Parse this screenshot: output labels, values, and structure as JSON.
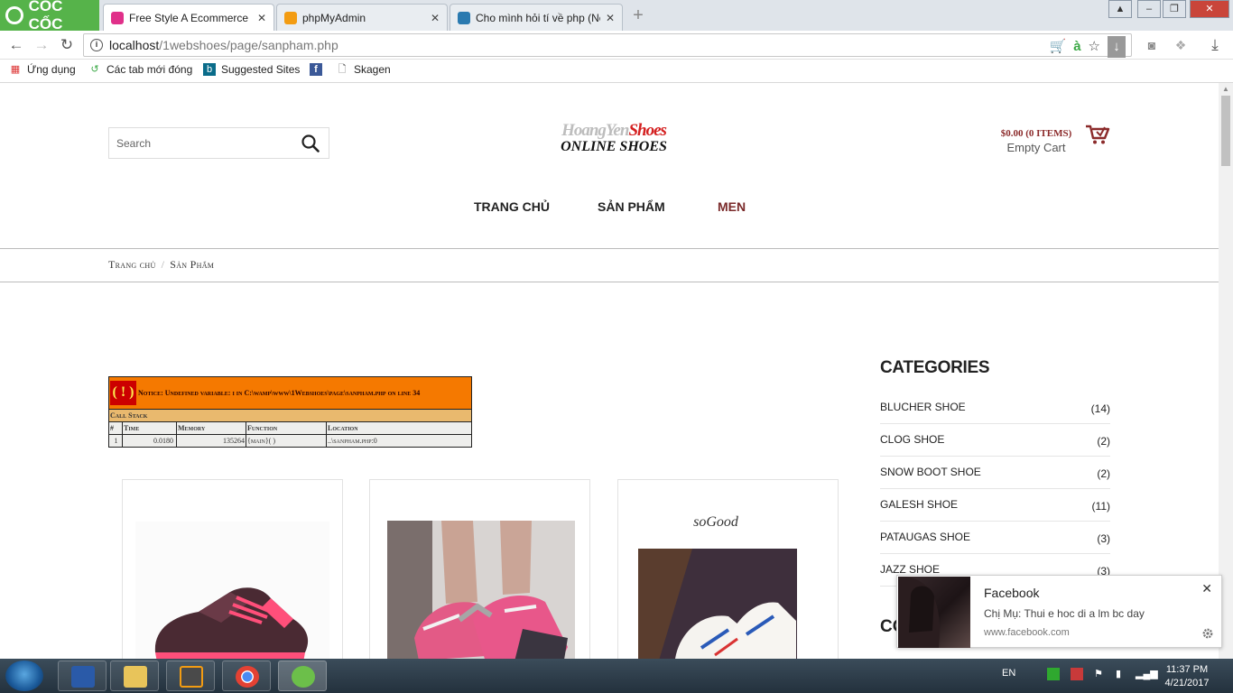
{
  "browser": {
    "brand": "CỐC CỐC",
    "tabs": [
      {
        "title": "Free Style A Ecommerce C",
        "active": true,
        "favicon_color": "#e0308a"
      },
      {
        "title": "phpMyAdmin",
        "active": false,
        "favicon_color": "#f39c12"
      },
      {
        "title": "Cho mình hỏi tí về php (Nc",
        "active": false,
        "favicon_color": "#2a7ab0"
      }
    ],
    "address": {
      "host": "localhost",
      "path": "/1webshoes/page/sanpham.php"
    },
    "bookmarks": [
      "Ứng dụng",
      "Các tab mới đóng",
      "Suggested Sites",
      "Skagen"
    ]
  },
  "site": {
    "search_placeholder": "Search",
    "logo_line1_a": "HoangYen",
    "logo_line1_b": "Shoes",
    "logo_line2": "ONLINE SHOES",
    "cart_amount": "$0.00 (0 ITEMS)",
    "cart_status": "Empty Cart",
    "nav": [
      "TRANG CHỦ",
      "SẢN PHẨM",
      "MEN"
    ],
    "breadcrumb": [
      "Trang chủ",
      "Sản Phẩm"
    ]
  },
  "notice": {
    "bang": "( ! )",
    "message": "Notice: Undefined variable: i in C:\\wamp\\www\\1Webshoes\\page\\sanpham.php on line 34",
    "call_stack": "Call Stack",
    "columns": [
      "#",
      "Time",
      "Memory",
      "Function",
      "Location"
    ],
    "row": [
      "1",
      "0.0180",
      "135264",
      "{main}( )",
      "..\\sanpham.php:0"
    ]
  },
  "sidebar": {
    "title": "CATEGORIES",
    "categories": [
      {
        "name": "BLUCHER SHOE",
        "count": "(14)"
      },
      {
        "name": "CLOG SHOE",
        "count": "(2)"
      },
      {
        "name": "SNOW BOOT SHOE",
        "count": "(2)"
      },
      {
        "name": "GALESH SHOE",
        "count": "(11)"
      },
      {
        "name": "PATAUGAS SHOE",
        "count": "(3)"
      },
      {
        "name": "JAZZ SHOE",
        "count": "(3)"
      }
    ],
    "next_title": "CO"
  },
  "products": [
    {
      "image": "pink-sneaker"
    },
    {
      "image": "pink-sneaker-worn"
    },
    {
      "image": "white-sneaker-so-good",
      "caption": "soGood"
    }
  ],
  "toast": {
    "title": "Facebook",
    "message": "Chị Mụ: Thui e hoc di a lm bc day",
    "site": "www.facebook.com"
  },
  "taskbar": {
    "lang": "EN",
    "time": "11:37 PM",
    "date": "4/21/2017"
  },
  "colors": {
    "nav_accent": "#7a2a2a",
    "notice_orange": "#f57900",
    "notice_red": "#cc0000",
    "callstack_tan": "#e9b96e"
  }
}
